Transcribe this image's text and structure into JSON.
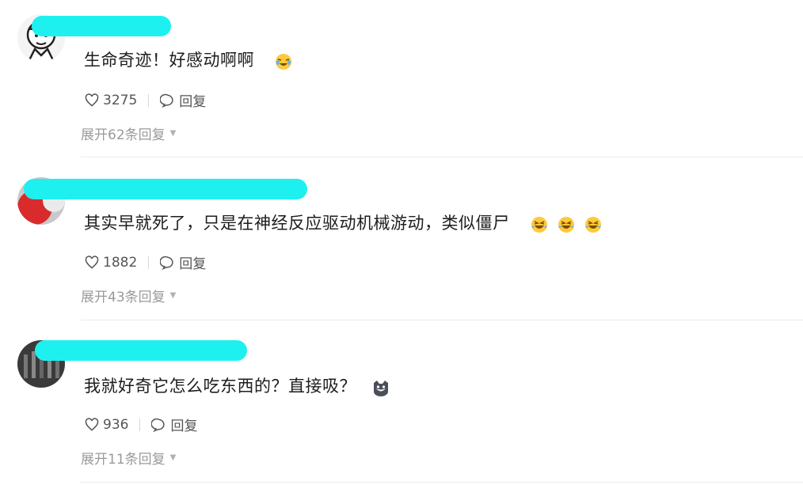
{
  "comments": [
    {
      "text": "生命奇迹！好感动啊啊",
      "emojis": [
        "crying-laugh-icon"
      ],
      "likes": "3275",
      "reply_label": "回复",
      "expand_label": "展开62条回复"
    },
    {
      "text": "其实早就死了，只是在神经反应驱动机械游动，类似僵尸",
      "emojis": [
        "laughing-tears-icon",
        "laughing-tears-icon",
        "laughing-tears-icon"
      ],
      "likes": "1882",
      "reply_label": "回复",
      "expand_label": "展开43条回复"
    },
    {
      "text": "我就好奇它怎么吃东西的？直接吸？",
      "emojis": [
        "cat-face-icon"
      ],
      "likes": "936",
      "reply_label": "回复",
      "expand_label": "展开11条回复"
    }
  ],
  "colors": {
    "redaction": "#1ef0f0",
    "emoji_yellow": "#ffc93c"
  }
}
